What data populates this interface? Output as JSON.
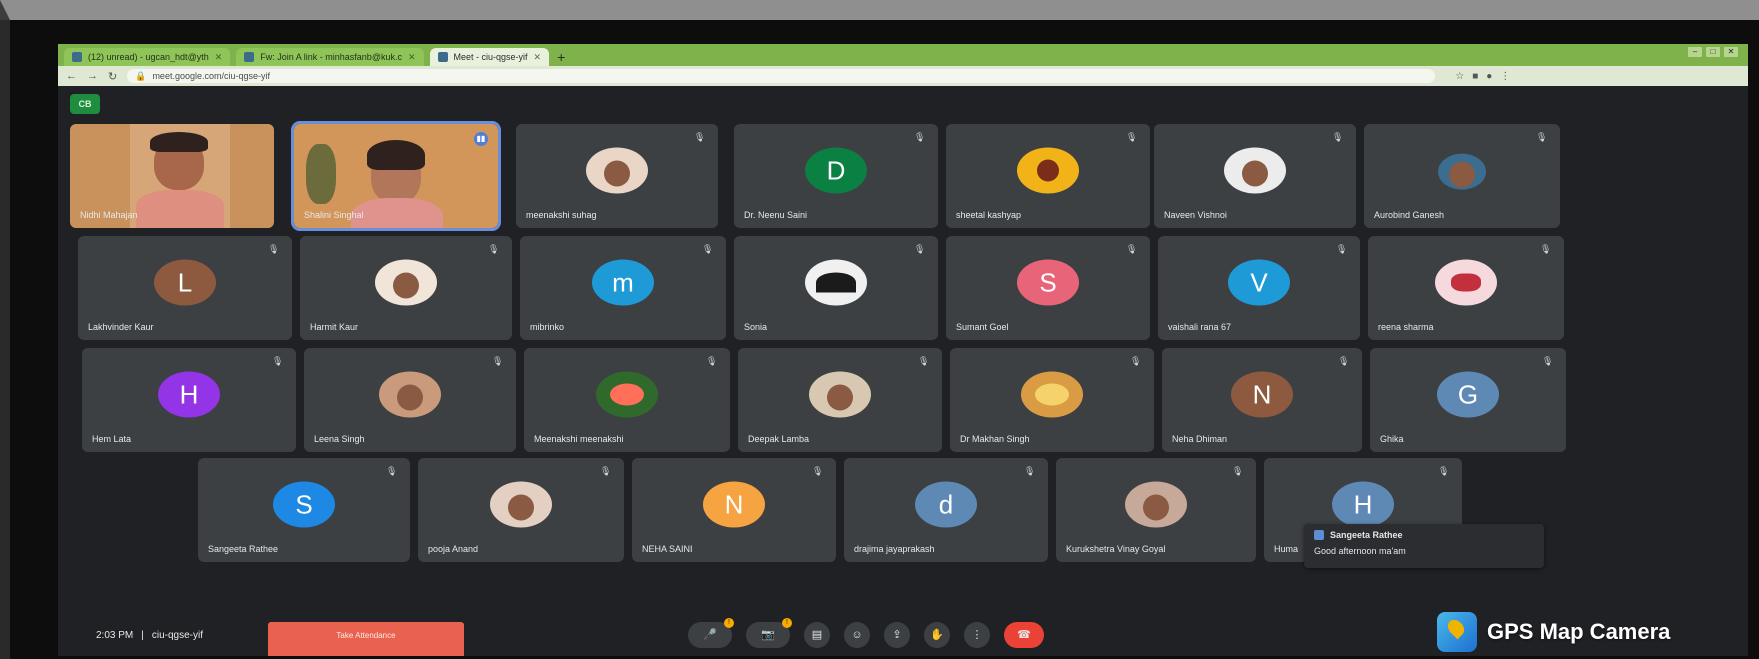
{
  "browser": {
    "tabs": [
      {
        "label": "(12) unread) - ugcan_hdt@yth",
        "active": false
      },
      {
        "label": "Fw: Join A link - minhasfanb@kuk.c",
        "active": false
      },
      {
        "label": "Meet - ciu-qgse-yif",
        "active": true
      }
    ],
    "url": "meet.google.com/ciu-qgse-yif"
  },
  "meet": {
    "cc_label": "CB",
    "participants_row1": [
      {
        "name": "Nidhi Mahajan",
        "kind": "video"
      },
      {
        "name": "Shalini Singhal",
        "kind": "video-speaking"
      },
      {
        "name": "meenakshi suhag",
        "kind": "photo"
      },
      {
        "name": "Dr. Neenu Saini",
        "kind": "letter",
        "letter": "D",
        "color": "#0b8043"
      },
      {
        "name": "sheetal kashyap",
        "kind": "photo-yellow"
      },
      {
        "name": "Naveen Vishnoi",
        "kind": "photo"
      },
      {
        "name": "Aurobind Ganesh",
        "kind": "photo-small"
      }
    ],
    "participants_row2": [
      {
        "name": "Lakhvinder Kaur",
        "kind": "letter",
        "letter": "L",
        "color": "#8d5a3f"
      },
      {
        "name": "Harmit Kaur",
        "kind": "photo"
      },
      {
        "name": "mibrinko",
        "kind": "letter",
        "letter": "m",
        "color": "#1e9bd6"
      },
      {
        "name": "Sonia",
        "kind": "photo-dark"
      },
      {
        "name": "Sumant Goel",
        "kind": "letter",
        "letter": "S",
        "color": "#e86478"
      },
      {
        "name": "vaishali rana 67",
        "kind": "letter",
        "letter": "V",
        "color": "#1e9bd6"
      },
      {
        "name": "reena sharma",
        "kind": "photo-pink"
      }
    ],
    "participants_row3": [
      {
        "name": "Hem Lata",
        "kind": "letter",
        "letter": "H",
        "color": "#9334e6"
      },
      {
        "name": "Leena Singh",
        "kind": "photo"
      },
      {
        "name": "Meenakshi meenakshi",
        "kind": "photo-flower"
      },
      {
        "name": "Deepak Lamba",
        "kind": "photo"
      },
      {
        "name": "Dr Makhan Singh",
        "kind": "photo-flower"
      },
      {
        "name": "Neha Dhiman",
        "kind": "letter",
        "letter": "N",
        "color": "#8d5a3f"
      },
      {
        "name": "Ghika",
        "kind": "letter",
        "letter": "G",
        "color": "#5f89b5"
      }
    ],
    "participants_row4": [
      {
        "name": "Sangeeta Rathee",
        "kind": "letter",
        "letter": "S",
        "color": "#1e88e5"
      },
      {
        "name": "pooja Anand",
        "kind": "photo"
      },
      {
        "name": "NEHA SAINI",
        "kind": "letter",
        "letter": "N",
        "color": "#f6a341"
      },
      {
        "name": "drajima jayaprakash",
        "kind": "letter",
        "letter": "d",
        "color": "#5f89b5"
      },
      {
        "name": "Kurukshetra Vinay Goyal",
        "kind": "photo"
      },
      {
        "name": "Huma",
        "kind": "letter",
        "letter": "H",
        "color": "#5f89b5"
      }
    ],
    "chat_toast": {
      "sender": "Sangeeta Rathee",
      "message": "Good afternoon ma'am"
    },
    "bottom": {
      "time": "2:03 PM",
      "meeting_code": "ciu-qgse-yif",
      "attendance_label": "Take Attendance"
    }
  },
  "watermark": {
    "text": "GPS Map Camera"
  },
  "icons": {
    "mic_off": "mic-off-icon",
    "speaking": "speaking-icon"
  },
  "colors": {
    "meet_bg": "#202124",
    "tile_bg": "#3c4043",
    "tabbar": "#7fb24a",
    "end_call": "#ea4335",
    "attendance": "#e8624f"
  }
}
